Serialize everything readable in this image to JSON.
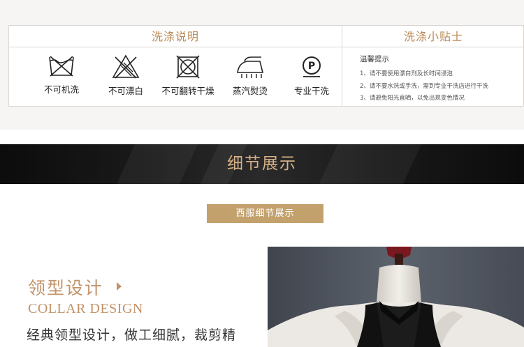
{
  "care": {
    "left_title": "洗涤说明",
    "right_title": "洗涤小贴士",
    "items": [
      {
        "icon": "no-machine-wash-icon",
        "label": "不可机洗"
      },
      {
        "icon": "no-bleach-icon",
        "label": "不可漂白"
      },
      {
        "icon": "no-tumble-dry-icon",
        "label": "不可翻转干燥"
      },
      {
        "icon": "steam-iron-icon",
        "label": "蒸汽熨烫"
      },
      {
        "icon": "professional-dry-clean-icon",
        "label": "专业干洗"
      }
    ],
    "tips_title": "温馨提示",
    "tips": [
      "1、请不要使用漂白剂及长时间浸泡",
      "2、请不要水洗或手洗，需到专业干洗店进行干洗",
      "3、请避免阳光直晒，以免出现变色情况"
    ]
  },
  "banner": {
    "title": "细节展示"
  },
  "badge": {
    "label": "西服细节展示"
  },
  "collar": {
    "title": "领型设计",
    "subtitle_en": "COLLAR DESIGN",
    "description": "经典领型设计，做工细腻，裁剪精"
  },
  "colors": {
    "accent_gold": "#c2936a",
    "badge_gold": "#c3a16d",
    "banner_text": "#d8b187",
    "banner_dark": "#111111"
  }
}
